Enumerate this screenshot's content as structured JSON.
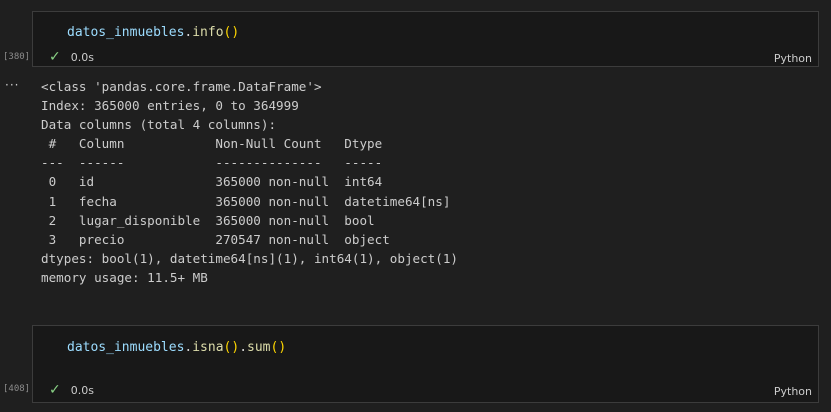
{
  "cells": [
    {
      "exec_count": "[380]",
      "code": {
        "object": "datos_inmuebles",
        "dot": ".",
        "method": "info",
        "open_paren": "(",
        "close_paren": ")"
      },
      "status": {
        "check_icon": "✓",
        "duration": "0.0s"
      },
      "language": "Python"
    },
    {
      "exec_count": "[408]",
      "code": {
        "object": "datos_inmuebles",
        "dot1": ".",
        "method1": "isna",
        "open1": "(",
        "close1": ")",
        "dot2": ".",
        "method2": "sum",
        "open2": "(",
        "close2": ")"
      },
      "status": {
        "check_icon": "✓",
        "duration": "0.0s"
      },
      "language": "Python"
    }
  ],
  "output": {
    "toggle_icon": "···",
    "lines": [
      "<class 'pandas.core.frame.DataFrame'>",
      "Index: 365000 entries, 0 to 364999",
      "Data columns (total 4 columns):",
      " #   Column            Non-Null Count   Dtype         ",
      "---  ------            --------------   -----         ",
      " 0   id                365000 non-null  int64         ",
      " 1   fecha             365000 non-null  datetime64[ns]",
      " 2   lugar_disponible  365000 non-null  bool          ",
      " 3   precio            270547 non-null  object        ",
      "dtypes: bool(1), datetime64[ns](1), int64(1), object(1)",
      "memory usage: 11.5+ MB"
    ]
  }
}
